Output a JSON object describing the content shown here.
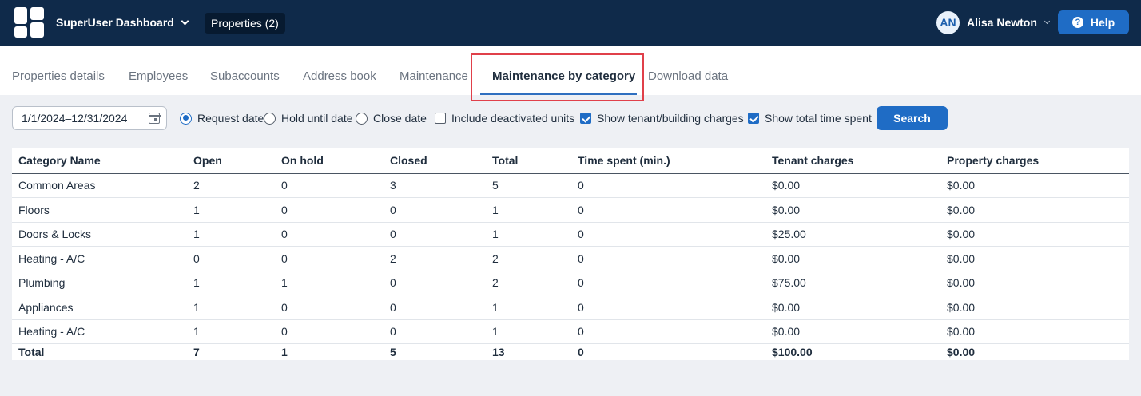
{
  "header": {
    "brand": "SuperUser Dashboard",
    "properties_pill": "Properties (2)",
    "user_initials": "AN",
    "user_name": "Alisa Newton",
    "help_label": "Help"
  },
  "tabs": [
    {
      "label": "Properties details"
    },
    {
      "label": "Employees"
    },
    {
      "label": "Subaccounts"
    },
    {
      "label": "Address book"
    },
    {
      "label": "Maintenance"
    },
    {
      "label": "Maintenance by category",
      "active": true
    },
    {
      "label": "Download data"
    }
  ],
  "filters": {
    "date_range": "1/1/2024–12/31/2024",
    "radios": [
      {
        "label": "Request date",
        "selected": true
      },
      {
        "label": "Hold until date",
        "selected": false
      },
      {
        "label": "Close date",
        "selected": false
      }
    ],
    "checkboxes": [
      {
        "label": "Include deactivated units",
        "checked": false
      },
      {
        "label": "Show tenant/building charges",
        "checked": true
      },
      {
        "label": "Show total time spent",
        "checked": true
      }
    ],
    "search_label": "Search"
  },
  "table": {
    "columns": [
      "Category Name",
      "Open",
      "On hold",
      "Closed",
      "Total",
      "Time spent (min.)",
      "Tenant charges",
      "Property charges"
    ],
    "rows": [
      [
        "Common Areas",
        "2",
        "0",
        "3",
        "5",
        "0",
        "$0.00",
        "$0.00"
      ],
      [
        "Floors",
        "1",
        "0",
        "0",
        "1",
        "0",
        "$0.00",
        "$0.00"
      ],
      [
        "Doors & Locks",
        "1",
        "0",
        "0",
        "1",
        "0",
        "$25.00",
        "$0.00"
      ],
      [
        "Heating - A/C",
        "0",
        "0",
        "2",
        "2",
        "0",
        "$0.00",
        "$0.00"
      ],
      [
        "Plumbing",
        "1",
        "1",
        "0",
        "2",
        "0",
        "$75.00",
        "$0.00"
      ],
      [
        "Appliances",
        "1",
        "0",
        "0",
        "1",
        "0",
        "$0.00",
        "$0.00"
      ],
      [
        "Heating - A/C",
        "1",
        "0",
        "0",
        "1",
        "0",
        "$0.00",
        "$0.00"
      ]
    ],
    "total": [
      "Total",
      "7",
      "1",
      "5",
      "13",
      "0",
      "$100.00",
      "$0.00"
    ]
  },
  "colors": {
    "topbar": "#0f2a4a",
    "accent": "#1f6cc5",
    "highlight": "#e0404a"
  }
}
